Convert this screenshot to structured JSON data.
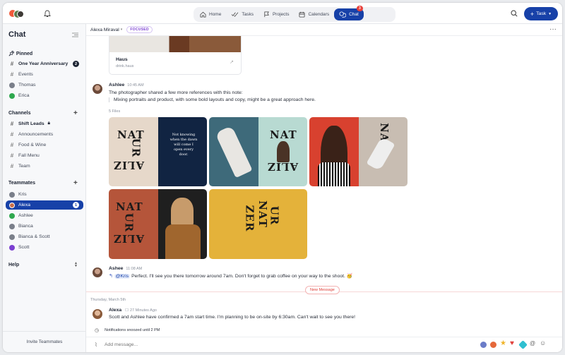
{
  "nav": {
    "home": "Home",
    "tasks": "Tasks",
    "projects": "Projects",
    "calendars": "Calendars",
    "chat": "Chat",
    "chat_badge": "3",
    "task_button": "Task"
  },
  "sidebar": {
    "title": "Chat",
    "pinned_label": "Pinned",
    "pinned": [
      {
        "label": "One Year Anniversary",
        "count": "2"
      },
      {
        "label": "Events"
      },
      {
        "label": "Thomas"
      },
      {
        "label": "Erica"
      }
    ],
    "channels_label": "Channels",
    "channels": [
      {
        "label": "Shift Leads"
      },
      {
        "label": "Announcements"
      },
      {
        "label": "Food & Wine"
      },
      {
        "label": "Fall Menu"
      },
      {
        "label": "Team"
      }
    ],
    "teammates_label": "Teammates",
    "teammates": [
      {
        "label": "Kris"
      },
      {
        "label": "Alexa",
        "count": "1"
      },
      {
        "label": "Ashlee"
      },
      {
        "label": "Bianca"
      },
      {
        "label": "Bianca & Scott"
      },
      {
        "label": "Scott"
      }
    ],
    "help_label": "Help",
    "invite": "Invite Teammates"
  },
  "chat": {
    "contact": "Alexa Miraval",
    "focused": "FOCUSED",
    "link_title": "Haus",
    "link_url": "drink.haus",
    "msg1": {
      "name": "Ashlee",
      "time": "10:45 AM",
      "text": "The photographer shared a few more references with this note:",
      "quote": "Mixing portraits and product, with some bold layouts and copy, might be a great approach here.",
      "files": "5 Files"
    },
    "thumb_texts": {
      "nat": "NAT",
      "ur": "UR",
      "aliz": "ALIZ",
      "zer": "ZER",
      "poem": "Not knowing when the dawn will come I open every door."
    },
    "msg2": {
      "name": "Ashee",
      "time": "11:08 AM",
      "mention": "@Kris",
      "text": "Perfect. I'll see you there tomorrow around 7am. Don't forget to grab coffee on your way to the shoot. 🥳"
    },
    "new_message": "New Message",
    "day": "Thursday, March 5th",
    "msg3": {
      "name": "Alexa",
      "time": "27 Minutes Ago",
      "text": "Scott and Ashlee have confirmed a 7am start time. I'm planning to be on-site by 6:30am. Can't wait to see you there!"
    },
    "snooze": "Notifications snoozed until 2 PM",
    "composer_placeholder": "Add message..."
  }
}
